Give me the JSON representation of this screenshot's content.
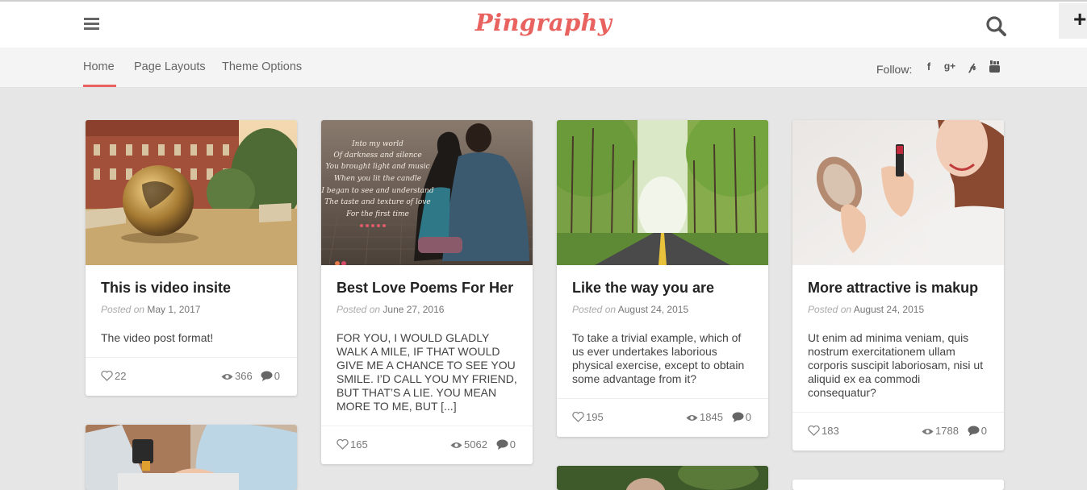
{
  "header": {
    "logo": "Pingraphy"
  },
  "nav": {
    "items": [
      "Home",
      "Page Layouts",
      "Theme Options"
    ],
    "follow_label": "Follow:"
  },
  "posts": [
    {
      "title": "This is video insite",
      "posted_label": "Posted on",
      "date": "May 1, 2017",
      "excerpt": "The video post format!",
      "likes": "22",
      "views": "366",
      "comments": "0"
    },
    {
      "title": "Best Love Poems For Her",
      "posted_label": "Posted on",
      "date": "June 27, 2016",
      "excerpt": "FOR YOU, I WOULD GLADLY WALK A MILE, IF THAT WOULD GIVE ME A CHANCE TO SEE YOU SMILE. I’D CALL YOU MY FRIEND, BUT THAT’S A LIE. YOU MEAN MORE TO ME, BUT [...]",
      "likes": "165",
      "views": "5062",
      "comments": "0",
      "image_text": [
        "Into my world",
        "Of darkness and silence",
        "You brought light and music",
        "When you lit the candle",
        "I began to see and understand",
        "The taste and texture of love",
        "For the first time"
      ]
    },
    {
      "title": "Like the way you are",
      "posted_label": "Posted on",
      "date": "August 24, 2015",
      "excerpt": "To take a trivial example, which of us ever undertakes laborious physical exercise, except to obtain some advantage from it?",
      "likes": "195",
      "views": "1845",
      "comments": "0"
    },
    {
      "title": "More attractive is makup",
      "posted_label": "Posted on",
      "date": "August 24, 2015",
      "excerpt": "Ut enim ad minima veniam, quis nostrum exercitationem ullam corporis suscipit laboriosam, nisi ut aliquid ex ea commodi consequatur?",
      "likes": "183",
      "views": "1788",
      "comments": "0"
    }
  ],
  "colors": {
    "accent": "#e8625f",
    "background": "#e6e6e6"
  },
  "icons": [
    "menu-icon",
    "search-icon",
    "plus-icon",
    "facebook-icon",
    "google-plus-icon",
    "pinterest-icon",
    "youtube-icon",
    "heart-icon",
    "eye-icon",
    "comment-icon"
  ]
}
